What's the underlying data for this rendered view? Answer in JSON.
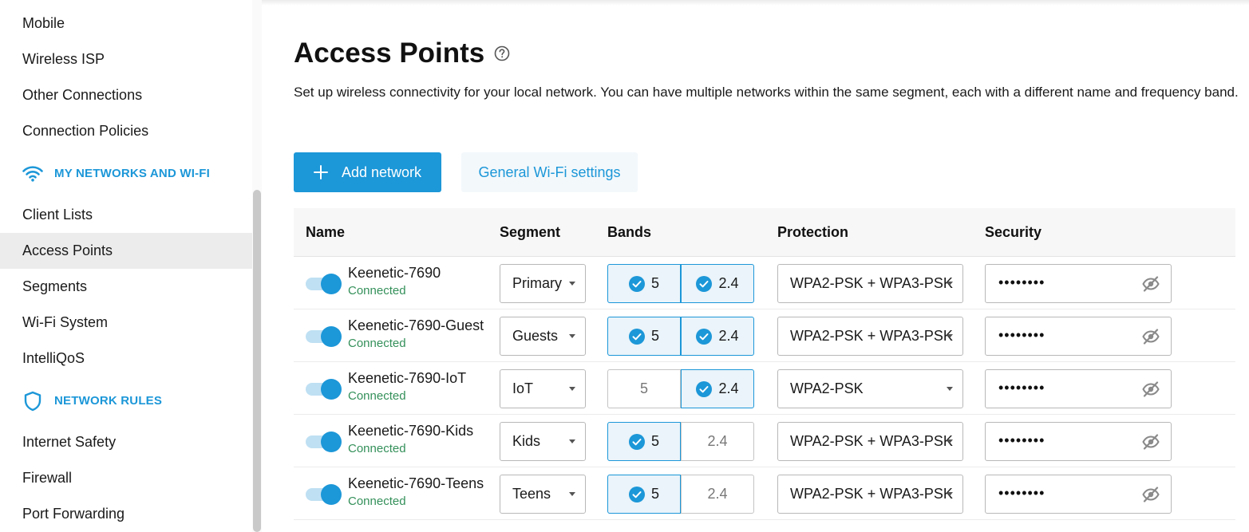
{
  "sidebar": {
    "items": [
      {
        "label": "Mobile"
      },
      {
        "label": "Wireless ISP"
      },
      {
        "label": "Other Connections"
      },
      {
        "label": "Connection Policies"
      }
    ],
    "section_networks": {
      "label": "MY NETWORKS AND WI-FI",
      "icon": "wifi-icon"
    },
    "network_items": [
      {
        "label": "Client Lists"
      },
      {
        "label": "Access Points",
        "active": true
      },
      {
        "label": "Segments"
      },
      {
        "label": "Wi-Fi System"
      },
      {
        "label": "IntelliQoS"
      }
    ],
    "section_rules": {
      "label": "NETWORK RULES",
      "icon": "shield-icon"
    },
    "rules_items": [
      {
        "label": "Internet Safety"
      },
      {
        "label": "Firewall"
      },
      {
        "label": "Port Forwarding"
      }
    ]
  },
  "main": {
    "title": "Access Points",
    "description": "Set up wireless connectivity for your local network. You can have multiple networks within the same segment, each with a different name and frequency band.",
    "add_button": "Add network",
    "settings_button": "General Wi-Fi settings"
  },
  "table": {
    "headers": {
      "name": "Name",
      "segment": "Segment",
      "bands": "Bands",
      "protection": "Protection",
      "security": "Security"
    },
    "rows": [
      {
        "name": "Keenetic-7690",
        "status": "Connected",
        "segment": "Primary",
        "band5": "5",
        "band24": "2.4",
        "band5_on": true,
        "band24_on": true,
        "protection": "WPA2-PSK + WPA3-PSK",
        "password": "••••••••",
        "enabled": true
      },
      {
        "name": "Keenetic-7690-Guest",
        "status": "Connected",
        "segment": "Guests",
        "band5": "5",
        "band24": "2.4",
        "band5_on": true,
        "band24_on": true,
        "protection": "WPA2-PSK + WPA3-PSK",
        "password": "••••••••",
        "enabled": true
      },
      {
        "name": "Keenetic-7690-IoT",
        "status": "Connected",
        "segment": "IoT",
        "band5": "5",
        "band24": "2.4",
        "band5_on": false,
        "band24_on": true,
        "protection": "WPA2-PSK",
        "password": "••••••••",
        "enabled": true
      },
      {
        "name": "Keenetic-7690-Kids",
        "status": "Connected",
        "segment": "Kids",
        "band5": "5",
        "band24": "2.4",
        "band5_on": true,
        "band24_on": false,
        "protection": "WPA2-PSK + WPA3-PSK",
        "password": "••••••••",
        "enabled": true
      },
      {
        "name": "Keenetic-7690-Teens",
        "status": "Connected",
        "segment": "Teens",
        "band5": "5",
        "band24": "2.4",
        "band5_on": true,
        "band24_on": false,
        "protection": "WPA2-PSK + WPA3-PSK",
        "password": "••••••••",
        "enabled": true
      }
    ]
  },
  "colors": {
    "accent": "#1c97d8",
    "status_connected": "#34905a"
  }
}
